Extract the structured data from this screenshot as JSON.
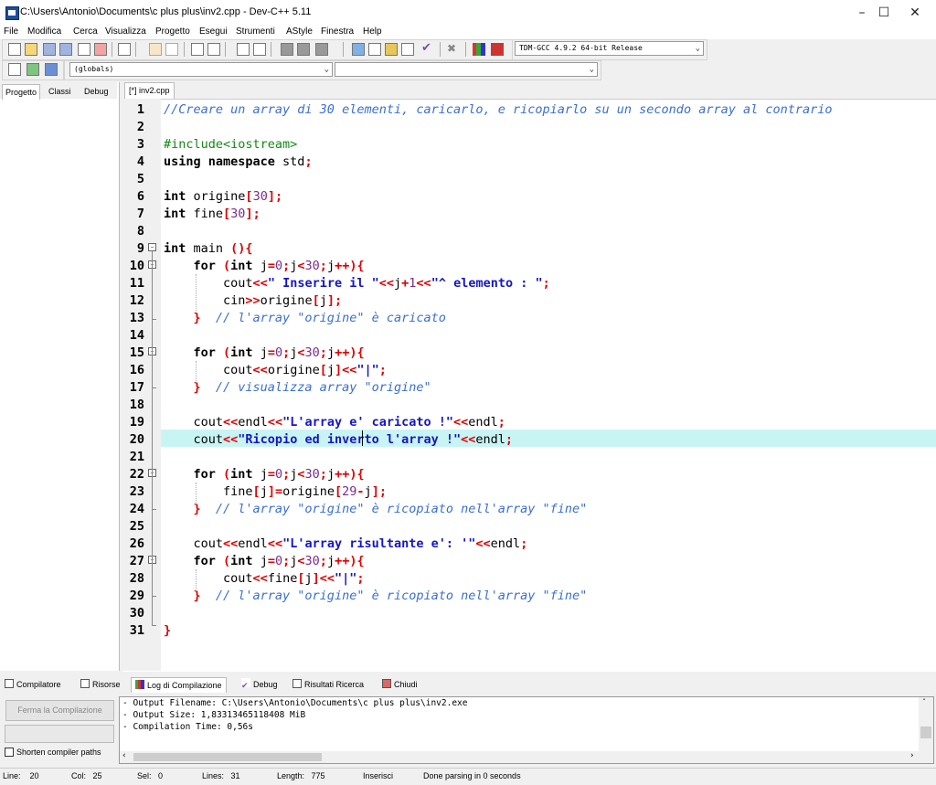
{
  "window": {
    "title": "C:\\Users\\Antonio\\Documents\\c plus plus\\inv2.cpp - Dev-C++ 5.11"
  },
  "menu": [
    "File",
    "Modifica",
    "Cerca",
    "Visualizza",
    "Progetto",
    "Esegui",
    "Strumenti",
    "AStyle",
    "Finestra",
    "Help"
  ],
  "toolbar": {
    "compiler_select": "TDM-GCC 4.9.2 64-bit Release",
    "scope_select": "(globals)",
    "member_select": ""
  },
  "left_tabs": [
    "Progetto",
    "Classi",
    "Debug"
  ],
  "editor": {
    "tab_label": "[*] inv2.cpp",
    "line_numbers": [
      "1",
      "2",
      "3",
      "4",
      "5",
      "6",
      "7",
      "8",
      "9",
      "10",
      "11",
      "12",
      "13",
      "14",
      "15",
      "16",
      "17",
      "18",
      "19",
      "20",
      "21",
      "22",
      "23",
      "24",
      "25",
      "26",
      "27",
      "28",
      "29",
      "30",
      "31"
    ]
  },
  "bottom_tabs": [
    "Compilatore",
    "Risorse",
    "Log di Compilazione",
    "Debug",
    "Risultati Ricerca",
    "Chiudi"
  ],
  "compile": {
    "stop_button": "Ferma la Compilazione",
    "shorten_label": "Shorten compiler paths",
    "log": [
      "- Output Filename: C:\\Users\\Antonio\\Documents\\c plus plus\\inv2.exe",
      "- Output Size: 1,83313465118408 MiB",
      "- Compilation Time: 0,56s"
    ]
  },
  "status": {
    "line_label": "Line:",
    "line": "20",
    "col_label": "Col:",
    "col": "25",
    "sel_label": "Sel:",
    "sel": "0",
    "lines_label": "Lines:",
    "lines": "31",
    "length_label": "Length:",
    "length": "775",
    "mode": "Inserisci",
    "message": "Done parsing in 0 seconds"
  },
  "colors": {
    "highlight_line": "#c9f4f4",
    "comment": "#3a6ed6",
    "string": "#1515c8",
    "symbol": "#e00000",
    "number": "#7a2c8c",
    "preprocessor": "#138a13"
  }
}
